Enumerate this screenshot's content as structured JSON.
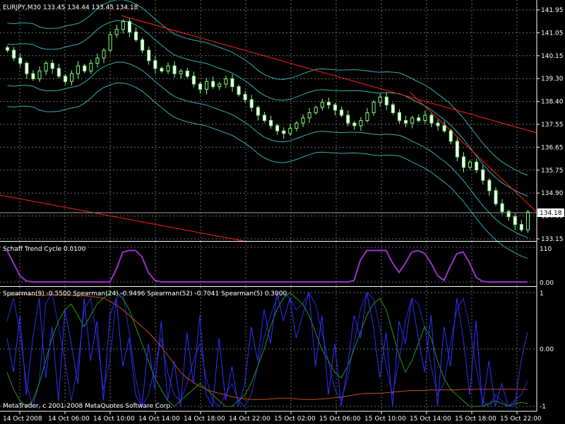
{
  "header": {
    "symbol": "EURJPY,M30",
    "open": "133.45",
    "high": "134.44",
    "low": "133.45",
    "close": "134.18",
    "text": "EURJPY,M30  133.45 134.44 133.45 134.18"
  },
  "current_price_label": "134.18",
  "indicator_stc_label": "Schaff Trend Cycle 0.0100",
  "indicator_spearman_label": "Spearman(9) -0.5500  Spearman(24) -0.9496  Spearman(52) -0.7041  Spearman(5) 0.3000",
  "copyright": "MetaTrader, c 2001-2008 MetaQuotes Software Corp.",
  "price_axis": [
    "141.95",
    "141.05",
    "140.15",
    "139.30",
    "138.40",
    "137.55",
    "136.65",
    "135.75",
    "134.90",
    "134.00",
    "133.15"
  ],
  "stc_axis": [
    "110",
    "0.00"
  ],
  "spearman_axis": [
    "1",
    "0.00",
    "-1"
  ],
  "time_axis": [
    "14 Oct 2008",
    "14 Oct 06:00",
    "14 Oct 10:00",
    "14 Oct 14:00",
    "14 Oct 18:00",
    "14 Oct 22:00",
    "15 Oct 02:00",
    "15 Oct 06:00",
    "15 Oct 10:00",
    "15 Oct 14:00",
    "15 Oct 18:00",
    "15 Oct 22:00"
  ],
  "colors": {
    "background": "#000000",
    "grid": "#6b6b6b",
    "candle": "#80ff80",
    "bands": "#2fb0b0",
    "trendline": "#ff2020",
    "stc": "#9b30d0",
    "spearman9": "#2a2ad0",
    "spearman24": "#1f9a1f",
    "spearman52": "#c05018",
    "spearman5": "#3030ff"
  },
  "chart_data": {
    "type": "candlestick",
    "price_range": [
      133.15,
      141.95
    ],
    "closes": [
      140.4,
      140.1,
      139.9,
      139.5,
      139.3,
      139.6,
      139.9,
      139.7,
      139.4,
      139.2,
      139.5,
      139.8,
      139.6,
      139.9,
      140.1,
      140.4,
      141.0,
      141.2,
      141.5,
      141.1,
      140.8,
      140.4,
      140.0,
      139.7,
      139.6,
      139.8,
      139.5,
      139.6,
      139.4,
      139.1,
      138.9,
      139.2,
      139.0,
      139.1,
      139.3,
      139.0,
      138.7,
      138.5,
      138.2,
      137.9,
      137.7,
      137.5,
      137.3,
      137.2,
      137.4,
      137.6,
      137.8,
      138.0,
      138.2,
      138.4,
      138.3,
      138.1,
      137.9,
      137.6,
      137.5,
      137.7,
      138.0,
      138.4,
      138.6,
      138.3,
      138.0,
      137.7,
      137.6,
      137.8,
      137.7,
      137.9,
      137.6,
      137.5,
      137.3,
      136.9,
      136.3,
      135.9,
      136.1,
      135.8,
      135.4,
      135.0,
      134.5,
      134.2,
      134.0,
      133.7,
      133.5,
      134.18
    ],
    "stc": [
      100,
      60,
      20,
      3,
      0,
      0,
      0,
      0,
      0,
      0,
      0,
      0,
      0,
      0,
      0,
      0,
      0,
      40,
      95,
      100,
      100,
      80,
      30,
      5,
      0,
      0,
      0,
      0,
      0,
      0,
      0,
      0,
      0,
      0,
      0,
      0,
      0,
      0,
      0,
      0,
      0,
      0,
      0,
      0,
      0,
      0,
      0,
      0,
      0,
      0,
      0,
      0,
      0,
      0,
      5,
      70,
      100,
      100,
      100,
      100,
      60,
      30,
      60,
      95,
      100,
      90,
      60,
      20,
      5,
      50,
      90,
      95,
      60,
      15,
      2,
      0,
      0,
      0,
      0,
      0,
      0,
      0
    ],
    "spearman": {
      "Spearman(9)": [
        0.5,
        0.9,
        0.3,
        -0.6,
        -1,
        -0.6,
        0.8,
        1,
        0.4,
        -0.2,
        -0.9,
        -0.3,
        0.7,
        0.9,
        0.2,
        -0.7,
        -0.2,
        0.9,
        1,
        0.3,
        -0.5,
        -1,
        -0.8,
        -0.3,
        0.2,
        -0.4,
        -0.8,
        -0.9,
        -0.6,
        -0.2,
        0.1,
        -0.5,
        -0.9,
        -1,
        -0.8,
        -0.6,
        -0.9,
        -1,
        -0.8,
        -0.3,
        0.2,
        0.6,
        0.9,
        1,
        0.9,
        0.7,
        0.8,
        1,
        0.8,
        0.3,
        -0.2,
        -0.7,
        -0.9,
        -0.5,
        0.1,
        0.7,
        1,
        0.9,
        0.4,
        -0.3,
        -0.8,
        -0.2,
        0.5,
        0.9,
        0.8,
        0.4,
        -0.3,
        -0.8,
        -0.6,
        0.1,
        0.7,
        0.9,
        0.4,
        -0.3,
        -0.9,
        -1,
        -0.8,
        -0.9,
        -1,
        -0.9,
        -0.8,
        -0.55
      ],
      "Spearman(24)": [
        -0.4,
        -0.7,
        -0.9,
        -1,
        -0.9,
        -0.6,
        -0.2,
        0.2,
        0.5,
        0.7,
        0.8,
        0.6,
        0.4,
        0.6,
        0.8,
        0.9,
        1,
        1,
        0.9,
        0.7,
        0.4,
        0.1,
        -0.2,
        -0.5,
        -0.7,
        -0.9,
        -1,
        -0.9,
        -0.8,
        -0.7,
        -0.6,
        -0.7,
        -0.8,
        -0.9,
        -1,
        -1,
        -0.9,
        -0.8,
        -0.6,
        -0.3,
        0,
        0.4,
        0.7,
        0.9,
        1,
        0.9,
        0.8,
        0.6,
        0.3,
        0,
        -0.2,
        -0.4,
        -0.5,
        -0.3,
        0,
        0.3,
        0.6,
        0.8,
        0.9,
        0.7,
        0.3,
        -0.1,
        -0.4,
        -0.2,
        0.1,
        0.4,
        0.2,
        -0.2,
        -0.5,
        -0.7,
        -0.8,
        -0.9,
        -1,
        -1,
        -1,
        -0.95,
        -0.9,
        -0.95,
        -1,
        -0.95,
        -0.93,
        -0.95
      ],
      "Spearman(52)": [
        0.95,
        0.96,
        0.97,
        0.97,
        0.96,
        0.95,
        0.95,
        0.96,
        0.96,
        0.95,
        0.95,
        0.94,
        0.94,
        0.93,
        0.92,
        0.9,
        0.85,
        0.78,
        0.7,
        0.6,
        0.5,
        0.4,
        0.3,
        0.18,
        0.05,
        -0.1,
        -0.25,
        -0.4,
        -0.5,
        -0.58,
        -0.65,
        -0.7,
        -0.74,
        -0.77,
        -0.8,
        -0.83,
        -0.85,
        -0.87,
        -0.88,
        -0.88,
        -0.88,
        -0.87,
        -0.86,
        -0.86,
        -0.86,
        -0.87,
        -0.88,
        -0.88,
        -0.88,
        -0.87,
        -0.86,
        -0.85,
        -0.84,
        -0.82,
        -0.8,
        -0.78,
        -0.77,
        -0.77,
        -0.77,
        -0.76,
        -0.75,
        -0.74,
        -0.73,
        -0.72,
        -0.72,
        -0.72,
        -0.71,
        -0.71,
        -0.71,
        -0.71,
        -0.71,
        -0.7,
        -0.7,
        -0.7,
        -0.7,
        -0.7,
        -0.7,
        -0.7,
        -0.7,
        -0.7,
        -0.7,
        -0.7041
      ],
      "Spearman(5)": [
        0.2,
        -0.4,
        0.6,
        -0.8,
        0.2,
        0.9,
        -0.5,
        0.4,
        -0.9,
        0.7,
        0.1,
        -0.6,
        0.9,
        -0.2,
        0.5,
        -0.9,
        0.6,
        0.9,
        -0.3,
        0.2,
        -0.8,
        -1,
        0.1,
        -0.7,
        0.5,
        -0.9,
        -0.2,
        -1,
        0.3,
        -0.6,
        0.6,
        -0.8,
        -1,
        0.2,
        -0.9,
        -0.3,
        -1,
        -0.6,
        0.4,
        -0.2,
        0.7,
        0.1,
        1,
        0.5,
        0.9,
        0.2,
        0.6,
        1,
        -0.3,
        0.6,
        -0.8,
        0.1,
        -1,
        -0.3,
        0.6,
        0.2,
        1,
        0.4,
        -0.5,
        0.3,
        -1,
        0.5,
        0.1,
        0.9,
        0.2,
        -0.4,
        0.6,
        -1,
        0.4,
        -0.3,
        0.9,
        0.2,
        -0.8,
        0.5,
        -1,
        -0.2,
        -1,
        -0.6,
        -1,
        -1,
        -0.2,
        0.3
      ]
    }
  }
}
